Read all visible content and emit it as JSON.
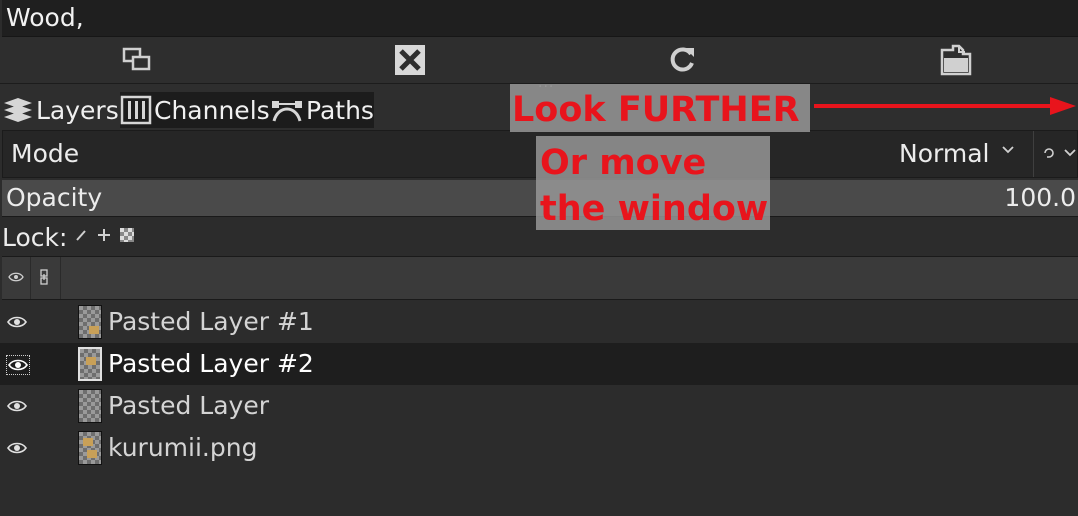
{
  "top_bar": {
    "text": "Wood,"
  },
  "buttons": [
    {
      "icon": "duplicate-icon"
    },
    {
      "icon": "close-x-icon"
    },
    {
      "icon": "refresh-icon"
    },
    {
      "icon": "paste-icon"
    }
  ],
  "tabs": [
    {
      "label": "Layers",
      "icon": "layers-icon"
    },
    {
      "label": "Channels",
      "icon": "channels-icon"
    },
    {
      "label": "Paths",
      "icon": "paths-icon"
    }
  ],
  "mode": {
    "label": "Mode",
    "value": "Normal"
  },
  "opacity": {
    "label": "Opacity",
    "value": "100.0"
  },
  "lock": {
    "label": "Lock:"
  },
  "layers": [
    {
      "name": "Pasted Layer #1",
      "selected": false
    },
    {
      "name": "Pasted Layer #2",
      "selected": true
    },
    {
      "name": "Pasted Layer",
      "selected": false
    },
    {
      "name": "kurumii.png",
      "selected": false
    }
  ],
  "annotation": {
    "line1": "Look FURTHER",
    "line2": "Or move",
    "line3": "the window",
    "color": "#e8141c"
  }
}
